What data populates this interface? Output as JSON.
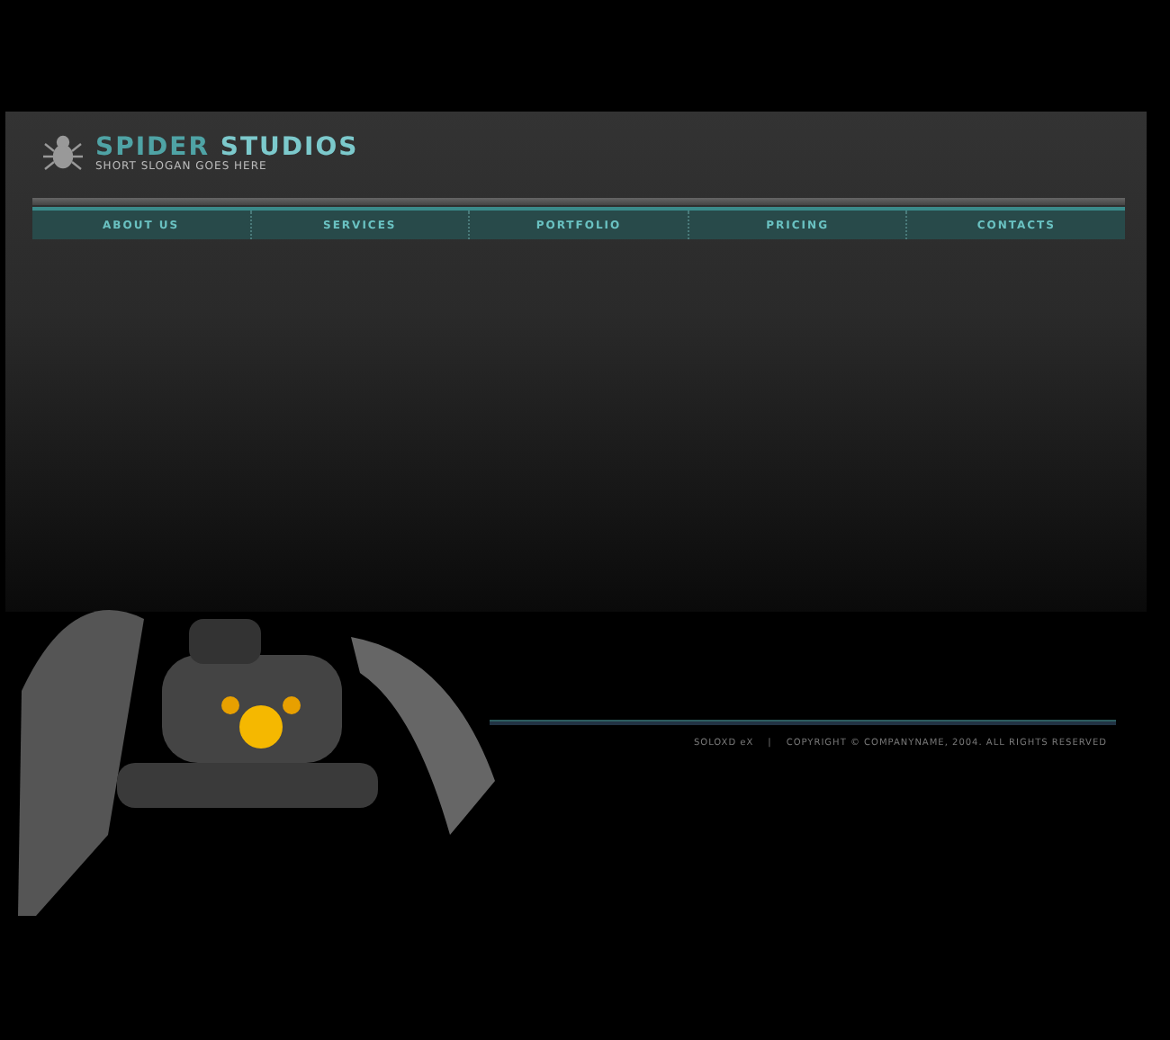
{
  "header": {
    "title": "SPIDER **STUDIOS**",
    "slogan": "SHORT SLOGAN GOES HERE"
  },
  "nav": [
    {
      "label": "ABOUT US"
    },
    {
      "label": "SERVICES"
    },
    {
      "label": "PORTFOLIO"
    },
    {
      "label": "PRICING"
    },
    {
      "label": "CONTACTS"
    }
  ],
  "footer": {
    "credit": "SOLOXD eX",
    "separator": "|",
    "copyright": "COPYRIGHT © COMPANYNAME, 2004. ALL RIGHTS RESERVED"
  }
}
